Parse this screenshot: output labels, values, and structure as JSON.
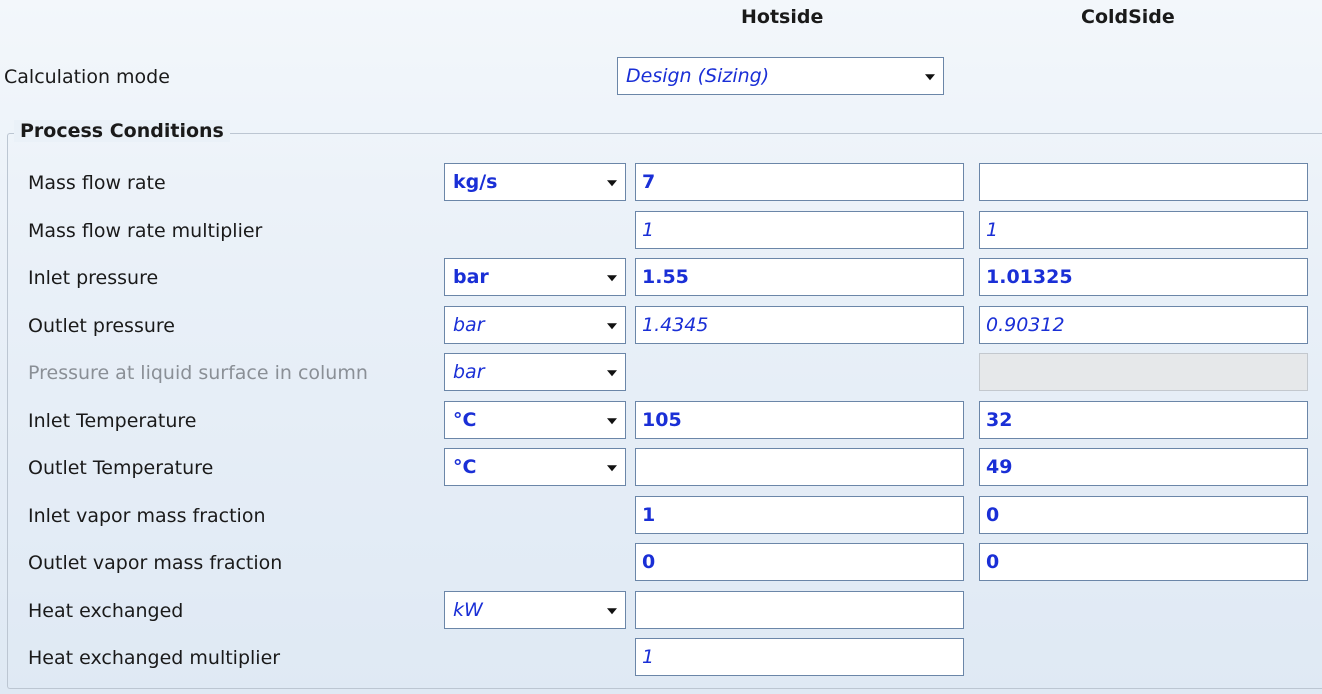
{
  "columns": {
    "hot": "Hotside",
    "cold": "ColdSide"
  },
  "calculation_mode": {
    "label": "Calculation mode",
    "value": "Design (Sizing)"
  },
  "process_conditions": {
    "title": "Process Conditions",
    "rows": [
      {
        "label": "Mass flow rate",
        "unit": "kg/s",
        "hot": "7",
        "cold": ""
      },
      {
        "label": "Mass flow rate multiplier",
        "unit": null,
        "hot": "1",
        "cold": "1"
      },
      {
        "label": "Inlet pressure",
        "unit": "bar",
        "hot": "1.55",
        "cold": "1.01325"
      },
      {
        "label": "Outlet pressure",
        "unit": "bar",
        "hot": "1.4345",
        "cold": "0.90312"
      },
      {
        "label": "Pressure at liquid surface in column",
        "unit": "bar",
        "hot": null,
        "cold": ""
      },
      {
        "label": "Inlet Temperature",
        "unit": "°C",
        "hot": "105",
        "cold": "32"
      },
      {
        "label": "Outlet Temperature",
        "unit": "°C",
        "hot": "",
        "cold": "49"
      },
      {
        "label": "Inlet vapor mass fraction",
        "unit": null,
        "hot": "1",
        "cold": "0"
      },
      {
        "label": "Outlet vapor mass fraction",
        "unit": null,
        "hot": "0",
        "cold": "0"
      },
      {
        "label": "Heat exchanged",
        "unit": "kW",
        "hot": "",
        "cold": null
      },
      {
        "label": "Heat exchanged multiplier",
        "unit": null,
        "hot": "1",
        "cold": null
      }
    ]
  },
  "colors": {
    "value_text": "#1a2fd6",
    "border": "#6b86a8",
    "disabled_text": "#8a8f96"
  }
}
